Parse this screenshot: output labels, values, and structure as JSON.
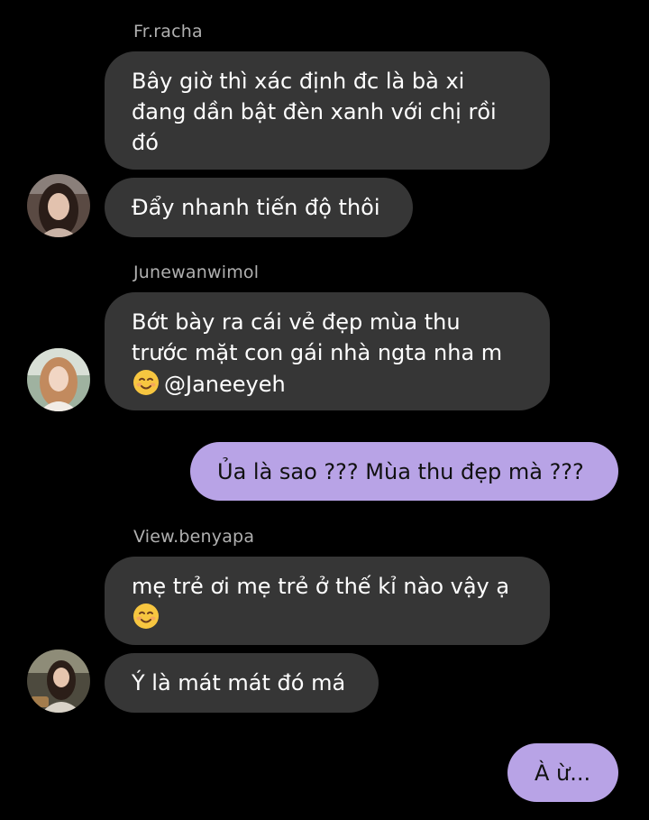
{
  "colors": {
    "background": "#000000",
    "incoming_bubble": "#363636",
    "outgoing_bubble": "#b8a3e6",
    "sender_name": "#b0b0b0"
  },
  "messages": [
    {
      "sender": "Fr.racha",
      "bubbles": [
        {
          "lines": [
            "Bây giờ thì xác định đc là bà xi",
            "đang dần bật đèn xanh với chị rồi",
            "đó"
          ]
        },
        {
          "lines": [
            "Đẩy nhanh tiến độ thôi"
          ]
        }
      ]
    },
    {
      "sender": "Junewanwimol",
      "bubbles": [
        {
          "lines": [
            "Bớt bày ra cái vẻ đẹp mùa thu",
            "trước mặt con gái nhà ngta nha m"
          ],
          "mention": "@Janeeyeh",
          "emoji": "smiling-face-icon"
        }
      ]
    },
    {
      "outgoing": true,
      "bubbles": [
        {
          "lines": [
            "Ủa là sao ??? Mùa thu đẹp mà ???"
          ]
        }
      ]
    },
    {
      "sender": "View.benyapa",
      "bubbles": [
        {
          "lines": [
            "mẹ trẻ ơi mẹ trẻ ở thế kỉ nào vậy ạ"
          ],
          "emoji": "smiling-face-icon"
        },
        {
          "lines": [
            "Ý là mát mát đó má"
          ]
        }
      ]
    },
    {
      "outgoing": true,
      "bubbles": [
        {
          "lines": [
            "À ừ..."
          ]
        }
      ]
    }
  ]
}
